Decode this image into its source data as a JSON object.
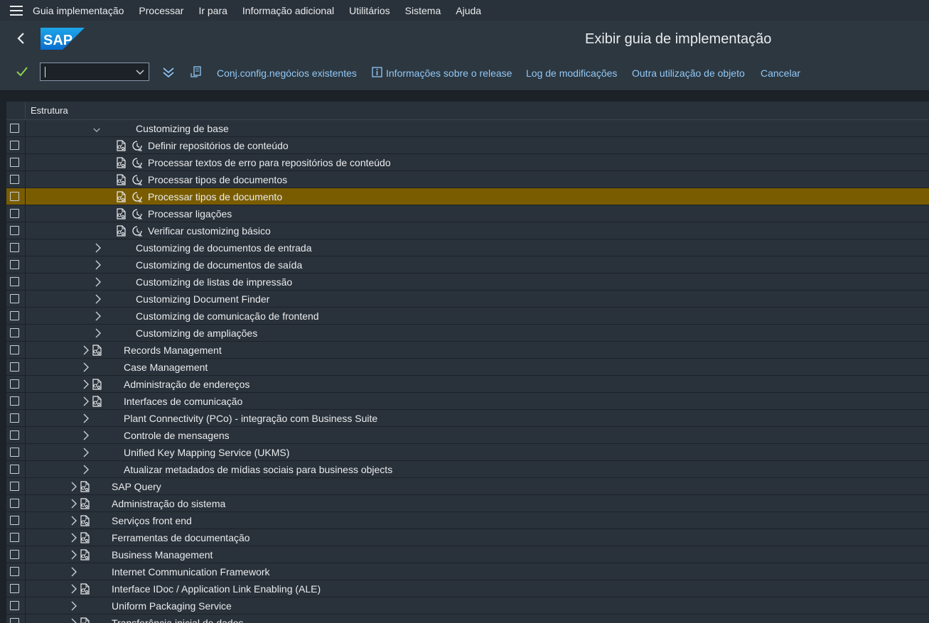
{
  "menu": {
    "items": [
      "Guia implementação",
      "Processar",
      "Ir para",
      "Informação adicional",
      "Utilitários",
      "Sistema",
      "Ajuda"
    ]
  },
  "titlebar": {
    "title": "Exibir guia de implementação",
    "logo_text": "SAP"
  },
  "toolbar": {
    "command_value": "",
    "links": [
      "Conj.config.negócios existentes",
      "Informações sobre o release",
      "Log de modificações",
      "Outra utilização de objeto",
      "Cancelar"
    ]
  },
  "tree": {
    "column_header": "Estrutura",
    "rows": [
      {
        "label": "Customizing de base",
        "expanded": true
      },
      {
        "label": "Definir repositórios de conteúdo"
      },
      {
        "label": "Processar textos de erro para repositórios de conteúdo"
      },
      {
        "label": "Processar tipos de documentos"
      },
      {
        "label": "Processar tipos de documento",
        "selected": true
      },
      {
        "label": "Processar ligações"
      },
      {
        "label": "Verificar customizing básico"
      },
      {
        "label": "Customizing de documentos de entrada"
      },
      {
        "label": "Customizing de documentos de saída"
      },
      {
        "label": "Customizing de listas de impressão"
      },
      {
        "label": "Customizing Document Finder"
      },
      {
        "label": "Customizing de comunicação de frontend"
      },
      {
        "label": "Customizing de ampliações"
      },
      {
        "label": "Records Management"
      },
      {
        "label": "Case Management"
      },
      {
        "label": "Administração de endereços"
      },
      {
        "label": "Interfaces de comunicação"
      },
      {
        "label": "Plant Connectivity (PCo) - integração com Business Suite"
      },
      {
        "label": "Controle de mensagens"
      },
      {
        "label": "Unified Key Mapping Service (UKMS)"
      },
      {
        "label": "Atualizar metadados de mídias sociais para business objects"
      },
      {
        "label": "SAP Query"
      },
      {
        "label": "Administração do sistema"
      },
      {
        "label": "Serviços front end"
      },
      {
        "label": "Ferramentas de documentação"
      },
      {
        "label": "Business Management"
      },
      {
        "label": "Internet Communication Framework"
      },
      {
        "label": "Interface IDoc / Application Link Enabling (ALE)"
      },
      {
        "label": "Uniform Packaging Service"
      },
      {
        "label": "Transferência inicial de dados"
      }
    ]
  },
  "colors": {
    "background": "#1c2228",
    "shell": "#2d3740",
    "row": "#29313a",
    "selected_row": "#7a5c00",
    "link": "#91c8f6",
    "sap_blue": "#0a6ed1"
  }
}
